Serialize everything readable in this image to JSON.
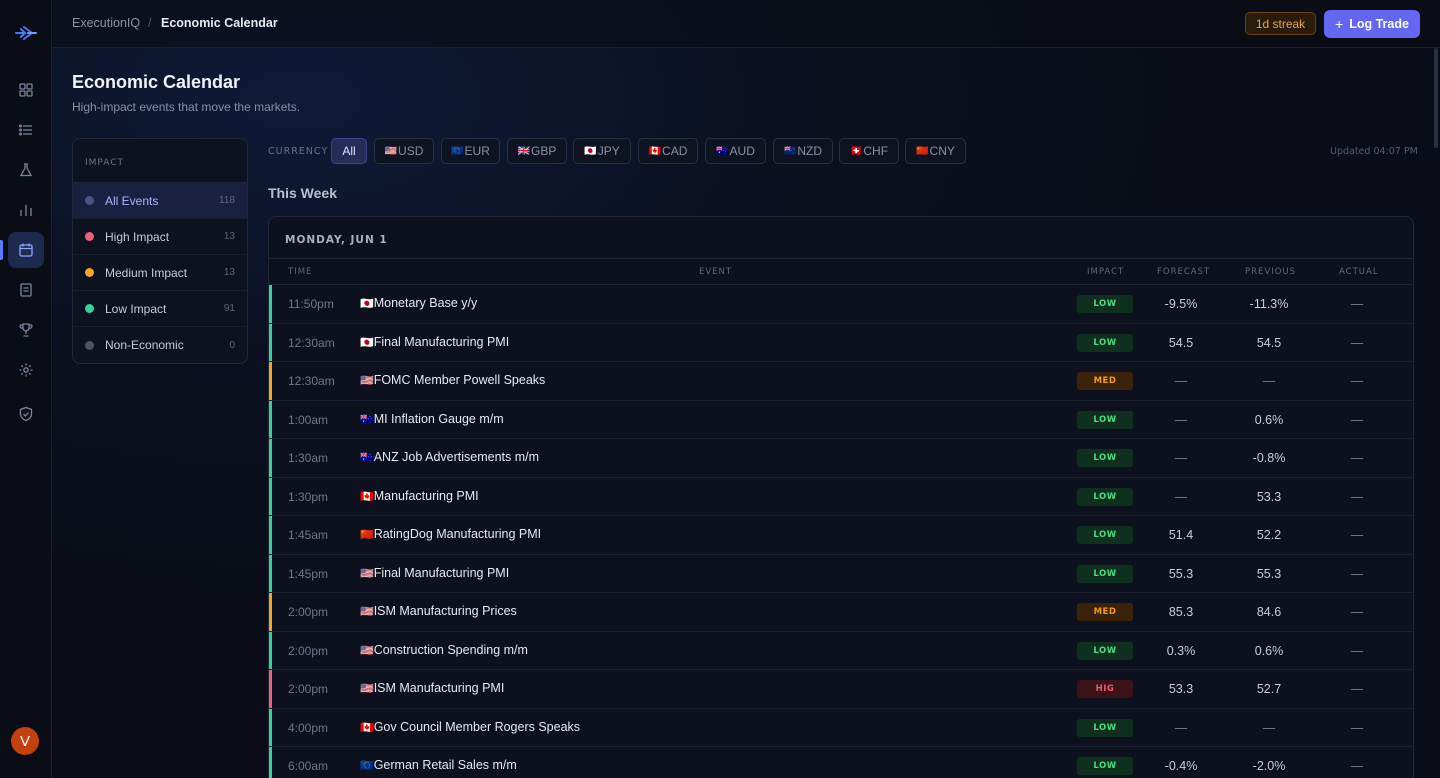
{
  "app": {
    "breadcrumb_root": "ExecutionIQ",
    "breadcrumb_sep": "/",
    "breadcrumb_current": "Economic Calendar",
    "streak": "1d streak",
    "log_trade": "Log Trade",
    "avatar_initial": "V"
  },
  "sidebar": {
    "icons": [
      "dashboard-icon",
      "list-icon",
      "flask-icon",
      "bar-chart-icon",
      "calendar-icon",
      "document-icon",
      "trophy-icon",
      "gear-icon",
      "shield-icon"
    ],
    "active": "calendar-icon"
  },
  "page": {
    "title": "Economic Calendar",
    "subtitle": "High-impact events that move the markets."
  },
  "impact_filter": {
    "heading": "IMPACT",
    "items": [
      {
        "label": "All Events",
        "count": "118",
        "color": "#4a5380"
      },
      {
        "label": "High Impact",
        "count": "13",
        "color": "#f0607a"
      },
      {
        "label": "Medium Impact",
        "count": "13",
        "color": "#f5a524"
      },
      {
        "label": "Low Impact",
        "count": "91",
        "color": "#34d399"
      },
      {
        "label": "Non-Economic",
        "count": "0",
        "color": "#4b5366"
      }
    ],
    "selected": "All Events"
  },
  "currency_filter": {
    "label": "CURRENCY",
    "chips": [
      {
        "label": "All",
        "flag": ""
      },
      {
        "label": "USD",
        "flag": "🇺🇸"
      },
      {
        "label": "EUR",
        "flag": "🇪🇺"
      },
      {
        "label": "GBP",
        "flag": "🇬🇧"
      },
      {
        "label": "JPY",
        "flag": "🇯🇵"
      },
      {
        "label": "CAD",
        "flag": "🇨🇦"
      },
      {
        "label": "AUD",
        "flag": "🇦🇺"
      },
      {
        "label": "NZD",
        "flag": "🇳🇿"
      },
      {
        "label": "CHF",
        "flag": "🇨🇭"
      },
      {
        "label": "CNY",
        "flag": "🇨🇳"
      }
    ],
    "selected": "All",
    "updated": "Updated 04:07 PM"
  },
  "week_title": "This Week",
  "table": {
    "day": "MONDAY, JUN 1",
    "columns": {
      "time": "TIME",
      "event": "EVENT",
      "impact": "IMPACT",
      "forecast": "FORECAST",
      "previous": "PREVIOUS",
      "actual": "ACTUAL"
    },
    "impact_colors": {
      "LOW": "#34d399",
      "MED": "#f5a524",
      "HIG": "#f0607a"
    },
    "rows": [
      {
        "time": "11:50pm",
        "flag": "🇯🇵",
        "event": "Monetary Base y/y",
        "impact": "LOW",
        "forecast": "-9.5%",
        "previous": "-11.3%",
        "actual": "—"
      },
      {
        "time": "12:30am",
        "flag": "🇯🇵",
        "event": "Final Manufacturing PMI",
        "impact": "LOW",
        "forecast": "54.5",
        "previous": "54.5",
        "actual": "—"
      },
      {
        "time": "12:30am",
        "flag": "🇺🇸",
        "event": "FOMC Member Powell Speaks",
        "impact": "MED",
        "forecast": "—",
        "previous": "—",
        "actual": "—"
      },
      {
        "time": "1:00am",
        "flag": "🇦🇺",
        "event": "MI Inflation Gauge m/m",
        "impact": "LOW",
        "forecast": "—",
        "previous": "0.6%",
        "actual": "—"
      },
      {
        "time": "1:30am",
        "flag": "🇦🇺",
        "event": "ANZ Job Advertisements m/m",
        "impact": "LOW",
        "forecast": "—",
        "previous": "-0.8%",
        "actual": "—"
      },
      {
        "time": "1:30pm",
        "flag": "🇨🇦",
        "event": "Manufacturing PMI",
        "impact": "LOW",
        "forecast": "—",
        "previous": "53.3",
        "actual": "—"
      },
      {
        "time": "1:45am",
        "flag": "🇨🇳",
        "event": "RatingDog Manufacturing PMI",
        "impact": "LOW",
        "forecast": "51.4",
        "previous": "52.2",
        "actual": "—"
      },
      {
        "time": "1:45pm",
        "flag": "🇺🇸",
        "event": "Final Manufacturing PMI",
        "impact": "LOW",
        "forecast": "55.3",
        "previous": "55.3",
        "actual": "—"
      },
      {
        "time": "2:00pm",
        "flag": "🇺🇸",
        "event": "ISM Manufacturing Prices",
        "impact": "MED",
        "forecast": "85.3",
        "previous": "84.6",
        "actual": "—"
      },
      {
        "time": "2:00pm",
        "flag": "🇺🇸",
        "event": "Construction Spending m/m",
        "impact": "LOW",
        "forecast": "0.3%",
        "previous": "0.6%",
        "actual": "—"
      },
      {
        "time": "2:00pm",
        "flag": "🇺🇸",
        "event": "ISM Manufacturing PMI",
        "impact": "HIG",
        "forecast": "53.3",
        "previous": "52.7",
        "actual": "—"
      },
      {
        "time": "4:00pm",
        "flag": "🇨🇦",
        "event": "Gov Council Member Rogers Speaks",
        "impact": "LOW",
        "forecast": "—",
        "previous": "—",
        "actual": "—"
      },
      {
        "time": "6:00am",
        "flag": "🇪🇺",
        "event": "German Retail Sales m/m",
        "impact": "LOW",
        "forecast": "-0.4%",
        "previous": "-2.0%",
        "actual": "—"
      }
    ]
  }
}
